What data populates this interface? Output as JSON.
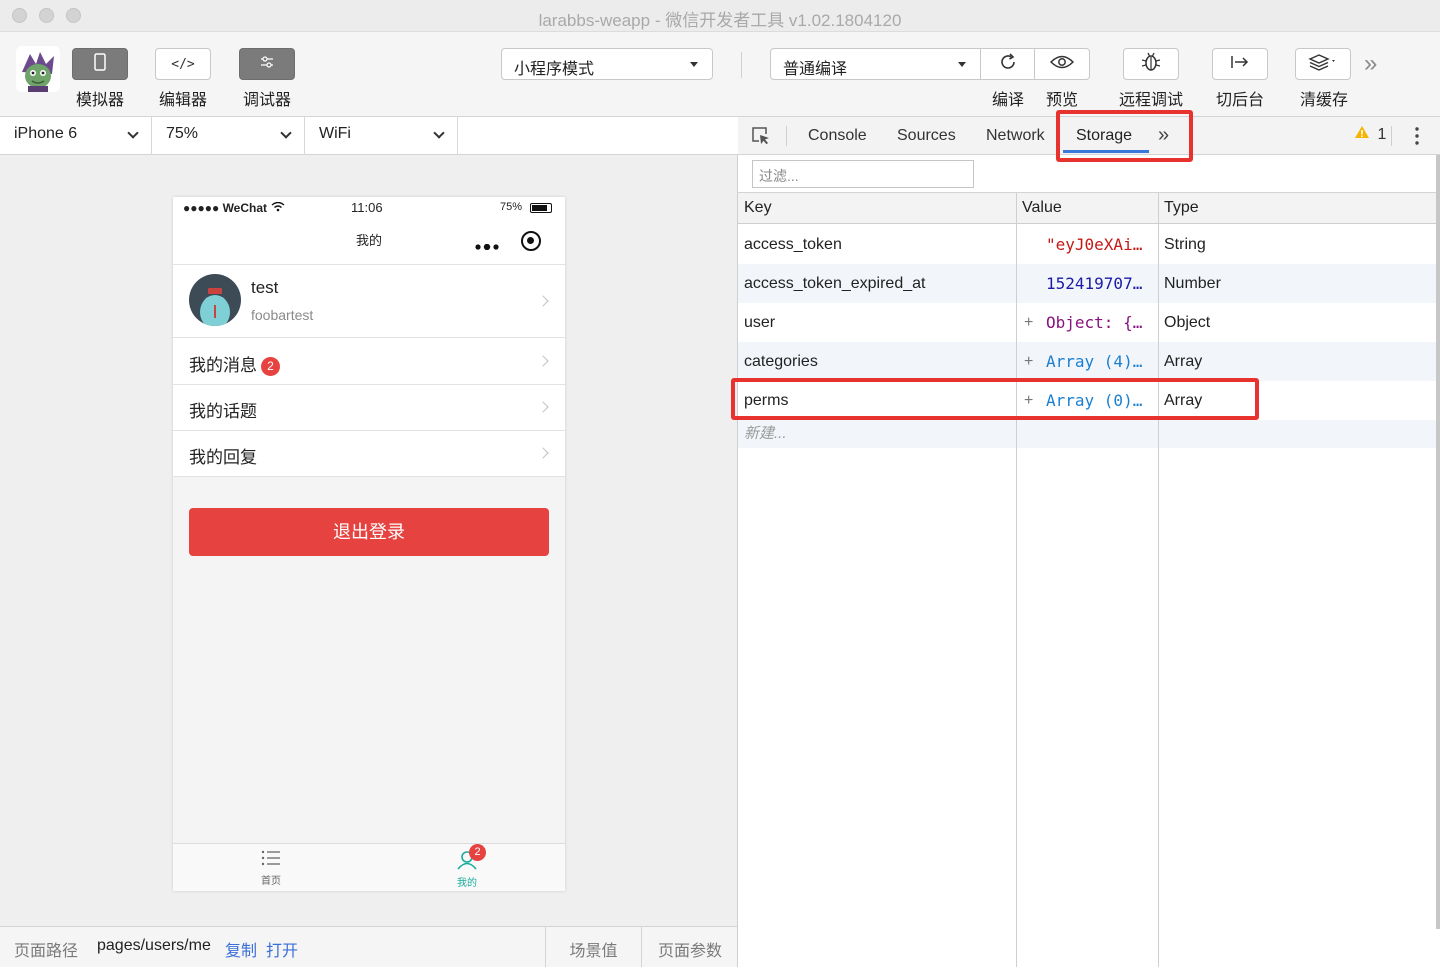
{
  "window": {
    "title": "larabbs-weapp - 微信开发者工具 v1.02.1804120"
  },
  "toolbar": {
    "left": [
      {
        "label": "模拟器",
        "icon": "phone-icon"
      },
      {
        "label": "编辑器",
        "icon": "code-icon"
      },
      {
        "label": "调试器",
        "icon": "debug-icon"
      }
    ],
    "mode_select": "小程序模式",
    "compile_select": "普通编译",
    "right": [
      {
        "label": "编译",
        "icon": "refresh-icon"
      },
      {
        "label": "预览",
        "icon": "eye-icon"
      },
      {
        "label": "远程调试",
        "icon": "bug-icon"
      },
      {
        "label": "切后台",
        "icon": "switch-icon"
      },
      {
        "label": "清缓存",
        "icon": "layers-icon"
      }
    ],
    "more": "»"
  },
  "device_bar": {
    "device": "iPhone 6",
    "zoom": "75%",
    "network": "WiFi"
  },
  "phone": {
    "status": {
      "carrier": "●●●●● WeChat",
      "time": "11:06",
      "battery": "75%"
    },
    "nav_title": "我的",
    "user": {
      "name": "test",
      "sub": "foobartest"
    },
    "menu": [
      {
        "label": "我的消息",
        "badge": "2"
      },
      {
        "label": "我的话题"
      },
      {
        "label": "我的回复"
      }
    ],
    "logout": "退出登录",
    "tabs": [
      {
        "label": "首页",
        "color": "#666666"
      },
      {
        "label": "我的",
        "color": "#1aad9c",
        "badge": "2"
      }
    ]
  },
  "bottom_bar": {
    "path_label": "页面路径",
    "path": "pages/users/me",
    "copy": "复制",
    "open": "打开",
    "scene": "场景值",
    "params": "页面参数"
  },
  "devtools": {
    "tabs": [
      "Console",
      "Sources",
      "Network",
      "Storage"
    ],
    "active_tab": "Storage",
    "more": "»",
    "warning_count": "1",
    "filter_placeholder": "过滤...",
    "columns": [
      "Key",
      "Value",
      "Type"
    ],
    "rows": [
      {
        "key": "access_token",
        "value_prefix": "",
        "value": "\"eyJ0eXAi…",
        "type": "String",
        "value_color": "#c41a16"
      },
      {
        "key": "access_token_expired_at",
        "value_prefix": "",
        "value": "152419707…",
        "type": "Number",
        "value_color": "#1a1aa6"
      },
      {
        "key": "user",
        "value_prefix": "+",
        "value": "Object: {…",
        "type": "Object",
        "value_color": "#881280"
      },
      {
        "key": "categories",
        "value_prefix": "+",
        "value": "Array (4)…",
        "type": "Array",
        "value_color": "#1a7fd0"
      },
      {
        "key": "perms",
        "value_prefix": "+",
        "value": "Array (0)…",
        "type": "Array",
        "value_color": "#1a7fd0"
      }
    ],
    "new_row": "新建..."
  },
  "colors": {
    "accent_red": "#e8322d",
    "logout_bg": "#e64340",
    "active_tab_line": "#3879d9"
  }
}
